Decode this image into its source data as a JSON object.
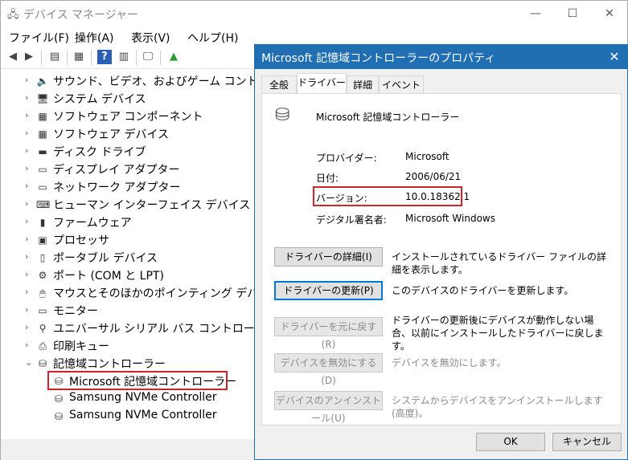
{
  "window": {
    "title": "デバイス マネージャー",
    "menu": [
      "ファイル(F)",
      "操作(A)",
      "表示(V)",
      "ヘルプ(H)"
    ]
  },
  "tree": {
    "items": [
      {
        "label": "サウンド、ビデオ、およびゲーム コントローラー",
        "icon": "speaker-icon",
        "glyph": "🔈"
      },
      {
        "label": "システム デバイス",
        "icon": "system-device-icon",
        "glyph": "🖥"
      },
      {
        "label": "ソフトウェア コンポーネント",
        "icon": "software-component-icon",
        "glyph": "▦"
      },
      {
        "label": "ソフトウェア デバイス",
        "icon": "software-device-icon",
        "glyph": "▦"
      },
      {
        "label": "ディスク ドライブ",
        "icon": "disk-drive-icon",
        "glyph": "▬"
      },
      {
        "label": "ディスプレイ アダプター",
        "icon": "display-adapter-icon",
        "glyph": "▭"
      },
      {
        "label": "ネットワーク アダプター",
        "icon": "network-adapter-icon",
        "glyph": "▭"
      },
      {
        "label": "ヒューマン インターフェイス デバイス",
        "icon": "hid-icon",
        "glyph": "⌨"
      },
      {
        "label": "ファームウェア",
        "icon": "firmware-icon",
        "glyph": "▮"
      },
      {
        "label": "プロセッサ",
        "icon": "processor-icon",
        "glyph": "▣"
      },
      {
        "label": "ポータブル デバイス",
        "icon": "portable-device-icon",
        "glyph": "▯"
      },
      {
        "label": "ポート (COM と LPT)",
        "icon": "port-icon",
        "glyph": "⚙"
      },
      {
        "label": "マウスとそのほかのポインティング デバイス",
        "icon": "mouse-icon",
        "glyph": "🖱"
      },
      {
        "label": "モニター",
        "icon": "monitor-icon",
        "glyph": "▭"
      },
      {
        "label": "ユニバーサル シリアル バス コントローラー",
        "icon": "usb-icon",
        "glyph": "⚲"
      },
      {
        "label": "印刷キュー",
        "icon": "printer-icon",
        "glyph": "⎙"
      },
      {
        "label": "記憶域コントローラー",
        "icon": "storage-controller-icon",
        "glyph": "⛁",
        "expanded": true
      }
    ],
    "children": [
      {
        "label": "Microsoft 記憶域コントローラー",
        "icon": "storage-controller-icon",
        "glyph": "⛁"
      },
      {
        "label": "Samsung NVMe Controller",
        "icon": "storage-controller-icon",
        "glyph": "⛁"
      },
      {
        "label": "Samsung NVMe Controller",
        "icon": "storage-controller-icon",
        "glyph": "⛁"
      }
    ]
  },
  "dialog": {
    "title": "Microsoft 記憶域コントローラーのプロパティ",
    "tabs": [
      "全般",
      "ドライバー",
      "詳細",
      "イベント"
    ],
    "active_tab": "ドライバー",
    "device_name": "Microsoft 記憶域コントローラー",
    "fields": {
      "provider_label": "プロバイダー:",
      "provider_value": "Microsoft",
      "date_label": "日付:",
      "date_value": "2006/06/21",
      "version_label": "バージョン:",
      "version_value": "10.0.18362.1",
      "signer_label": "デジタル署名者:",
      "signer_value": "Microsoft Windows"
    },
    "actions": [
      {
        "button": "ドライバーの詳細(I)",
        "desc": "インストールされているドライバー ファイルの詳細を表示します。",
        "enabled": true
      },
      {
        "button": "ドライバーの更新(P)",
        "desc": "このデバイスのドライバーを更新します。",
        "enabled": true
      },
      {
        "button": "ドライバーを元に戻す(R)",
        "desc": "ドライバーの更新後にデバイスが動作しない場合、以前にインストールしたドライバーに戻します。",
        "enabled": false
      },
      {
        "button": "デバイスを無効にする(D)",
        "desc": "デバイスを無効にします。",
        "enabled": false
      },
      {
        "button": "デバイスのアンインストール(U)",
        "desc": "システムからデバイスをアンインストールします (高度)。",
        "enabled": false
      }
    ],
    "ok_label": "OK",
    "cancel_label": "キャンセル"
  },
  "colors": {
    "dialog_accent": "#1f6fb2",
    "highlight_box": "#d0232a"
  }
}
